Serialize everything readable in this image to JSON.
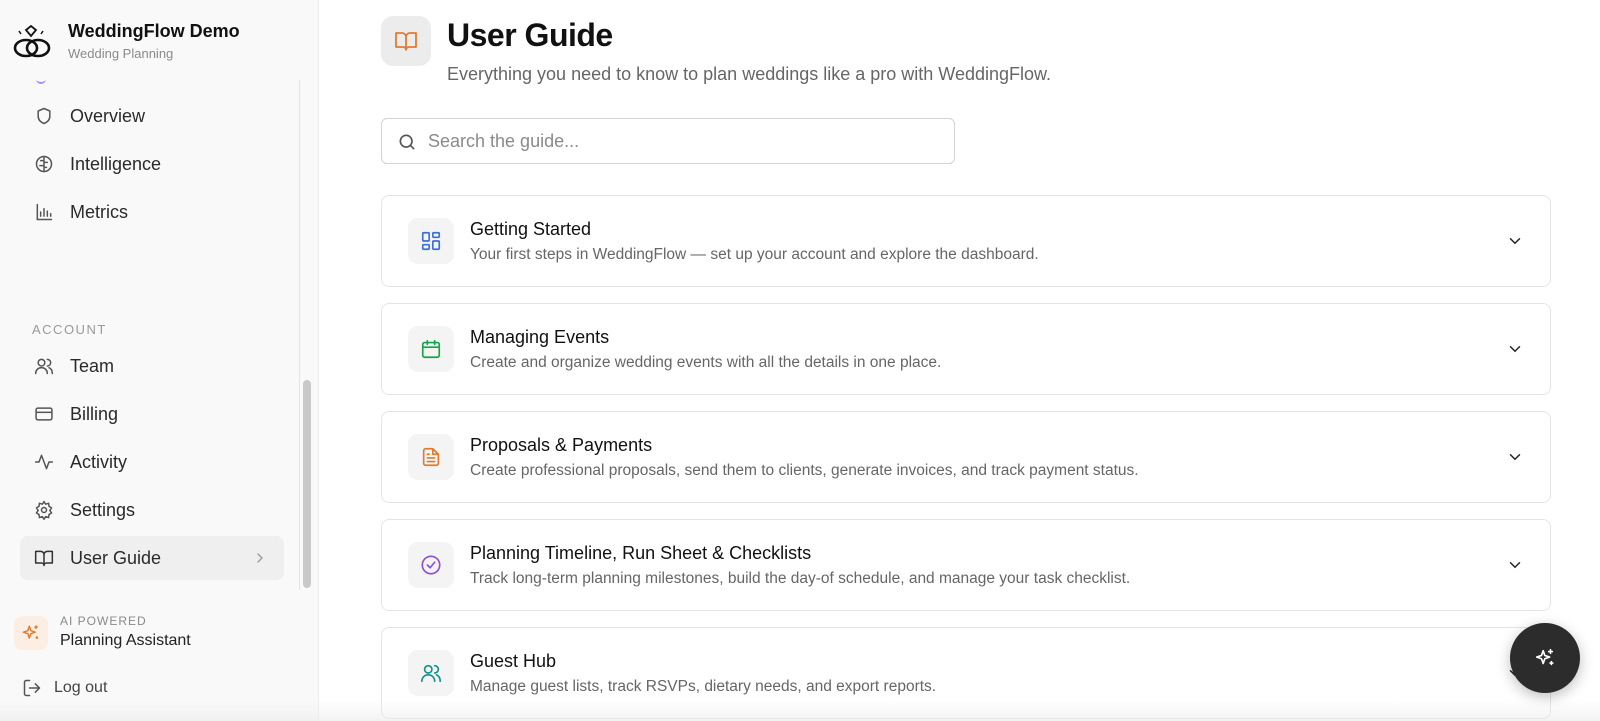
{
  "brand": {
    "name": "WeddingFlow Demo",
    "subtitle": "Wedding Planning",
    "logo_icon": "rings-logo-icon"
  },
  "sidebar": {
    "items_top": [
      {
        "label": "Overview",
        "icon": "shield-icon"
      },
      {
        "label": "Intelligence",
        "icon": "brain-icon"
      },
      {
        "label": "Metrics",
        "icon": "bar-chart-icon"
      }
    ],
    "section_account": "ACCOUNT",
    "items_account": [
      {
        "label": "Team",
        "icon": "users-icon"
      },
      {
        "label": "Billing",
        "icon": "credit-card-icon"
      },
      {
        "label": "Activity",
        "icon": "activity-icon"
      },
      {
        "label": "Settings",
        "icon": "gear-icon"
      },
      {
        "label": "User Guide",
        "icon": "book-open-icon",
        "active": true
      }
    ],
    "ai": {
      "kicker": "AI POWERED",
      "title": "Planning Assistant"
    },
    "logout": "Log out"
  },
  "main": {
    "title": "User Guide",
    "subtitle": "Everything you need to know to plan weddings like a pro with WeddingFlow.",
    "search_placeholder": "Search the guide...",
    "sections": [
      {
        "title": "Getting Started",
        "description": "Your first steps in WeddingFlow — set up your account and explore the dashboard.",
        "icon": "layout-grid-icon",
        "color": "#3b6fd8"
      },
      {
        "title": "Managing Events",
        "description": "Create and organize wedding events with all the details in one place.",
        "icon": "calendar-icon",
        "color": "#16a34a"
      },
      {
        "title": "Proposals & Payments",
        "description": "Create professional proposals, send them to clients, generate invoices, and track payment status.",
        "icon": "file-text-icon",
        "color": "#e07b2f"
      },
      {
        "title": "Planning Timeline, Run Sheet & Checklists",
        "description": "Track long-term planning milestones, build the day-of schedule, and manage your task checklist.",
        "icon": "check-circle-icon",
        "color": "#8b4fd8"
      },
      {
        "title": "Guest Hub",
        "description": "Manage guest lists, track RSVPs, dietary needs, and export reports.",
        "icon": "users-icon",
        "color": "#0f9488"
      }
    ]
  },
  "colors": {
    "accent_orange": "#e07b2f",
    "fab_bg": "#2c2c2c"
  }
}
